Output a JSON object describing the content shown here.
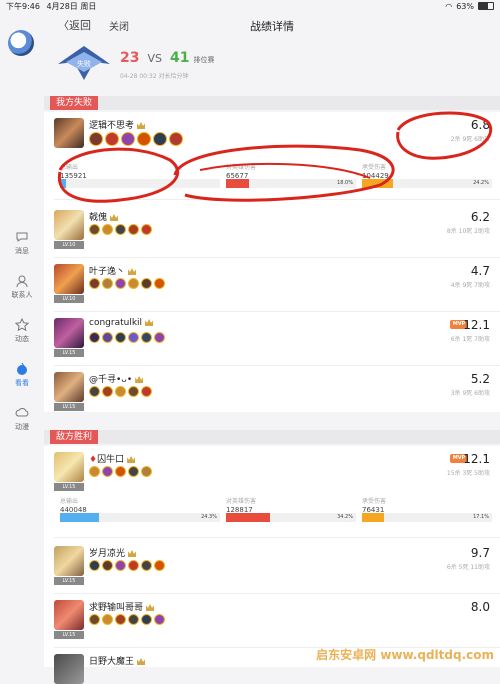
{
  "status_bar": {
    "time": "下午9:46",
    "date": "4月28日 周日",
    "battery": "63%"
  },
  "header": {
    "back_label": "返回",
    "close_label": "关闭",
    "title": "战绩详情"
  },
  "summary": {
    "emblem_text": "失败",
    "score_own": "23",
    "vs_label": "VS",
    "score_enemy": "41",
    "mode": "排位赛",
    "meta": "04-28 00:32 对长恰分钟"
  },
  "sidebar": {
    "items": [
      {
        "label": "消息",
        "icon": "chat-icon"
      },
      {
        "label": "联系人",
        "icon": "contacts-icon"
      },
      {
        "label": "动态",
        "icon": "star-icon"
      },
      {
        "label": "看看",
        "icon": "watch-icon"
      },
      {
        "label": "动漫",
        "icon": "cloud-icon"
      }
    ]
  },
  "own_team": {
    "label": "我方失败",
    "players": [
      {
        "name": "逻辑不思考",
        "level": "LV.10",
        "rating": "6.8",
        "kda": "2杀 9死 6助攻",
        "stats": [
          {
            "label": "总输出",
            "value": "135921",
            "pct": "",
            "color": "#52b0ee",
            "fraction": 0.04
          },
          {
            "label": "对英雄伤害",
            "value": "65677",
            "pct": "18.0%",
            "color": "#e74c3c",
            "fraction": 0.18
          },
          {
            "label": "承受伤害",
            "value": "104429",
            "pct": "24.2%",
            "color": "#f5a623",
            "fraction": 0.242
          }
        ]
      },
      {
        "name": "戟傀",
        "level": "LV.10",
        "rating": "6.2",
        "kda": "8杀 10死 2助攻"
      },
      {
        "name": "叶子逸丶",
        "level": "LV.10",
        "rating": "4.7",
        "kda": "4杀 9死 7助攻"
      },
      {
        "name": "congratulkil",
        "level": "LV.15",
        "rating": "12.1",
        "kda": "6杀 1死 7助攻",
        "mvp": "MVP"
      },
      {
        "name": "@千寻•ᴗ•",
        "level": "LV.15",
        "rating": "5.2",
        "kda": "3杀 9死 6助攻"
      }
    ]
  },
  "enemy_team": {
    "label": "敌方胜利",
    "players": [
      {
        "name": "囚牛口",
        "level": "LV.15",
        "rating": "12.1",
        "kda": "15杀 3死 5助攻",
        "mvp": "MVP",
        "stats": [
          {
            "label": "总输出",
            "value": "440048",
            "pct": "24.3%",
            "color": "#52b0ee",
            "fraction": 0.243
          },
          {
            "label": "对英雄伤害",
            "value": "128817",
            "pct": "34.2%",
            "color": "#e74c3c",
            "fraction": 0.342
          },
          {
            "label": "承受伤害",
            "value": "76431",
            "pct": "17.1%",
            "color": "#f5a623",
            "fraction": 0.171
          }
        ]
      },
      {
        "name": "岁月凉光",
        "level": "LV.15",
        "rating": "9.7",
        "kda": "6杀 5死 11助攻"
      },
      {
        "name": "求野输叫哥哥",
        "level": "LV.15",
        "rating": "8.0",
        "kda": ""
      },
      {
        "name": "日野大魔王",
        "level": "",
        "rating": "",
        "kda": ""
      }
    ]
  },
  "watermark": "启东安卓网 www.qdltdq.com"
}
